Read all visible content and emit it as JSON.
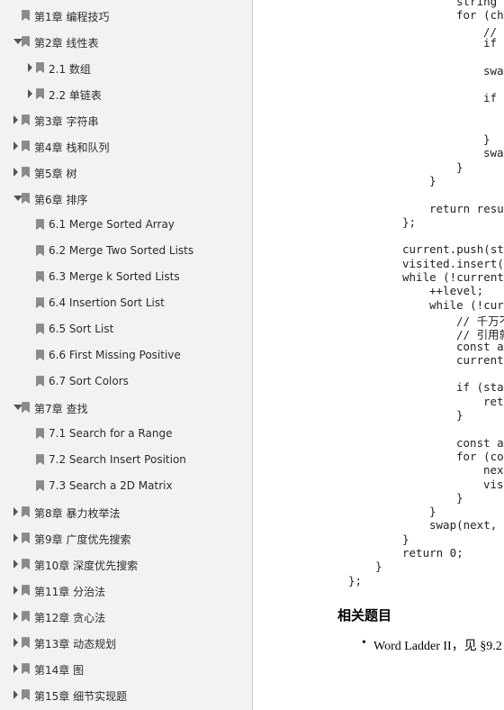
{
  "sidebar": {
    "items": [
      {
        "label": "第1章  编程技巧",
        "state": "none",
        "level": 0
      },
      {
        "label": "第2章  线性表",
        "state": "expanded",
        "level": 0
      },
      {
        "label": "2.1 数组",
        "state": "collapsed",
        "level": 1
      },
      {
        "label": "2.2 单链表",
        "state": "collapsed",
        "level": 1
      },
      {
        "label": "第3章  字符串",
        "state": "collapsed",
        "level": 0
      },
      {
        "label": "第4章  栈和队列",
        "state": "collapsed",
        "level": 0
      },
      {
        "label": "第5章  树",
        "state": "collapsed",
        "level": 0
      },
      {
        "label": "第6章  排序",
        "state": "expanded",
        "level": 0
      },
      {
        "label": "6.1 Merge Sorted Array",
        "state": "none",
        "level": 1
      },
      {
        "label": "6.2 Merge Two Sorted Lists",
        "state": "none",
        "level": 1
      },
      {
        "label": "6.3 Merge k Sorted Lists",
        "state": "none",
        "level": 1
      },
      {
        "label": "6.4 Insertion Sort List",
        "state": "none",
        "level": 1
      },
      {
        "label": "6.5 Sort List",
        "state": "none",
        "level": 1
      },
      {
        "label": "6.6 First Missing Positive",
        "state": "none",
        "level": 1
      },
      {
        "label": "6.7 Sort Colors",
        "state": "none",
        "level": 1
      },
      {
        "label": "第7章  查找",
        "state": "expanded",
        "level": 0
      },
      {
        "label": "7.1 Search for a Range",
        "state": "none",
        "level": 1
      },
      {
        "label": "7.2 Search Insert Position",
        "state": "none",
        "level": 1
      },
      {
        "label": "7.3 Search a 2D Matrix",
        "state": "none",
        "level": 1
      },
      {
        "label": "第8章  暴力枚举法",
        "state": "collapsed",
        "level": 0
      },
      {
        "label": "第9章  广度优先搜索",
        "state": "collapsed",
        "level": 0
      },
      {
        "label": "第10章  深度优先搜索",
        "state": "collapsed",
        "level": 0
      },
      {
        "label": "第11章  分治法",
        "state": "collapsed",
        "level": 0
      },
      {
        "label": "第12章  贪心法",
        "state": "collapsed",
        "level": 0
      },
      {
        "label": "第13章  动态规划",
        "state": "collapsed",
        "level": 0
      },
      {
        "label": "第14章  图",
        "state": "collapsed",
        "level": 0
      },
      {
        "label": "第15章  细节实现题",
        "state": "collapsed",
        "level": 0
      }
    ]
  },
  "code": {
    "lines": [
      {
        "indent": 8,
        "text": "string n"
      },
      {
        "indent": 8,
        "text": "for (cha"
      },
      {
        "indent": 12,
        "text": "// 防"
      },
      {
        "indent": 12,
        "text": "if ("
      },
      {
        "indent": 0,
        "text": ""
      },
      {
        "indent": 12,
        "text": "swap"
      },
      {
        "indent": 0,
        "text": ""
      },
      {
        "indent": 12,
        "text": "if ("
      },
      {
        "indent": 0,
        "text": ""
      },
      {
        "indent": 0,
        "text": ""
      },
      {
        "indent": 12,
        "text": "}"
      },
      {
        "indent": 12,
        "text": "swap"
      },
      {
        "indent": 8,
        "text": "}"
      },
      {
        "indent": 4,
        "text": "}"
      },
      {
        "indent": 0,
        "text": ""
      },
      {
        "indent": 4,
        "text": "return resul"
      },
      {
        "indent": 0,
        "text": "};"
      },
      {
        "indent": 0,
        "text": ""
      },
      {
        "indent": 0,
        "text": "current.push(sta"
      },
      {
        "indent": 0,
        "text": "visited.insert(s"
      },
      {
        "indent": 0,
        "text": "while (!current."
      },
      {
        "indent": 4,
        "text": "++level;"
      },
      {
        "indent": 4,
        "text": "while (!curr"
      },
      {
        "indent": 8,
        "text": "// 千万不"
      },
      {
        "indent": 8,
        "text": "// 引用就"
      },
      {
        "indent": 8,
        "text": "const au"
      },
      {
        "indent": 8,
        "text": "current."
      },
      {
        "indent": 0,
        "text": ""
      },
      {
        "indent": 8,
        "text": "if (stat"
      },
      {
        "indent": 12,
        "text": "retu"
      },
      {
        "indent": 8,
        "text": "}"
      },
      {
        "indent": 0,
        "text": ""
      },
      {
        "indent": 8,
        "text": "const au"
      },
      {
        "indent": 8,
        "text": "for (con"
      },
      {
        "indent": 12,
        "text": "next"
      },
      {
        "indent": 12,
        "text": "visi"
      },
      {
        "indent": 8,
        "text": "}"
      },
      {
        "indent": 4,
        "text": "}"
      },
      {
        "indent": 4,
        "text": "swap(next, c"
      },
      {
        "indent": 0,
        "text": "}"
      },
      {
        "indent": 0,
        "text": "return 0;"
      },
      {
        "indent": -4,
        "text": "}"
      },
      {
        "indent": -8,
        "text": "};"
      }
    ]
  },
  "related": {
    "heading": "相关题目",
    "bullet": "•",
    "item": "Word Ladder II，见 §9.2"
  }
}
